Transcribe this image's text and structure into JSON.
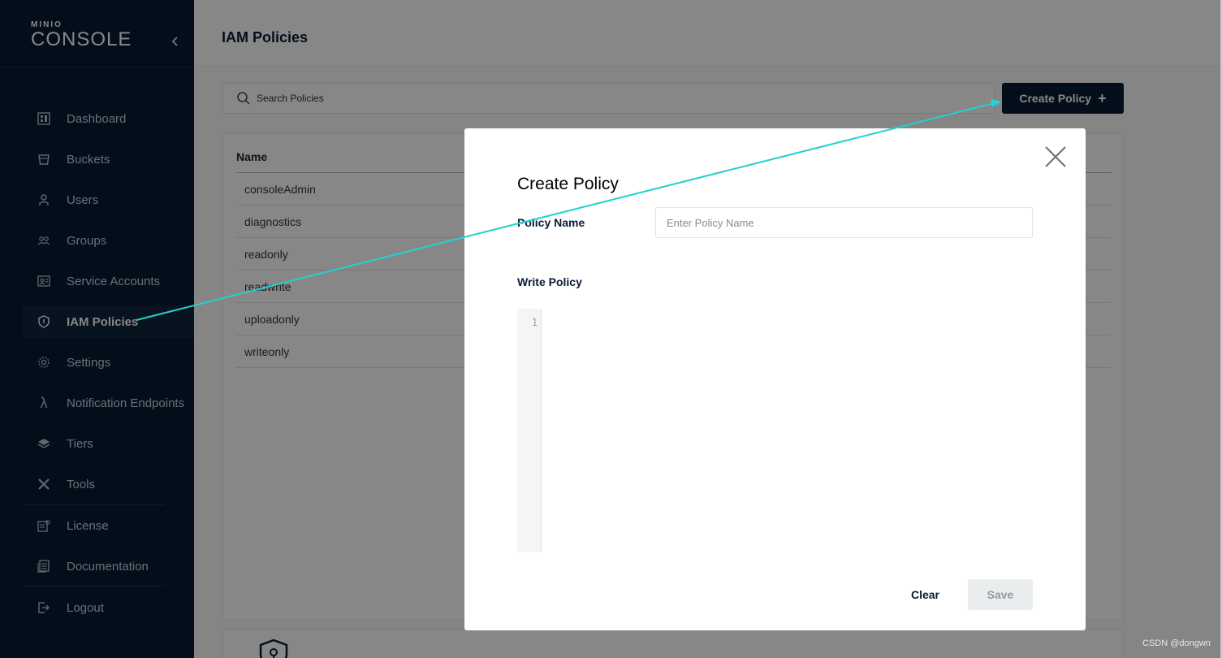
{
  "app": {
    "logo_small": "MINIO",
    "logo_big": "CONSOLE",
    "collapse_icon": "chevron-left-icon"
  },
  "sidebar": {
    "items": [
      {
        "label": "Dashboard",
        "icon": "dashboard-icon",
        "active": false
      },
      {
        "label": "Buckets",
        "icon": "bucket-icon",
        "active": false
      },
      {
        "label": "Users",
        "icon": "user-icon",
        "active": false
      },
      {
        "label": "Groups",
        "icon": "groups-icon",
        "active": false
      },
      {
        "label": "Service Accounts",
        "icon": "service-account-icon",
        "active": false
      },
      {
        "label": "IAM Policies",
        "icon": "shield-icon",
        "active": true
      },
      {
        "label": "Settings",
        "icon": "gear-icon",
        "active": false
      },
      {
        "label": "Notification Endpoints",
        "icon": "lambda-icon",
        "active": false
      },
      {
        "label": "Tiers",
        "icon": "layers-icon",
        "active": false
      },
      {
        "label": "Tools",
        "icon": "tools-icon",
        "active": false
      },
      {
        "label": "License",
        "icon": "license-icon",
        "active": false
      },
      {
        "label": "Documentation",
        "icon": "documentation-icon",
        "active": false
      },
      {
        "label": "Logout",
        "icon": "logout-icon",
        "active": false
      }
    ]
  },
  "header": {
    "title": "IAM Policies"
  },
  "search": {
    "placeholder": "Search Policies",
    "value": ""
  },
  "toolbar": {
    "create_label": "Create Policy",
    "create_icon": "plus-icon"
  },
  "table": {
    "column_header": "Name",
    "rows": [
      "consoleAdmin",
      "diagnostics",
      "readonly",
      "readwrite",
      "uploadonly",
      "writeonly"
    ]
  },
  "modal": {
    "title": "Create Policy",
    "policy_name_label": "Policy Name",
    "policy_name_placeholder": "Enter Policy Name",
    "policy_name_value": "",
    "write_policy_label": "Write Policy",
    "editor_line_number": "1",
    "clear_label": "Clear",
    "save_label": "Save"
  },
  "watermark": "CSDN @dongwn",
  "colors": {
    "sidebar_bg": "#081c33",
    "primary": "#081c33",
    "annotation_arrow": "#25d0d0",
    "save_disabled_bg": "#eaedee"
  }
}
